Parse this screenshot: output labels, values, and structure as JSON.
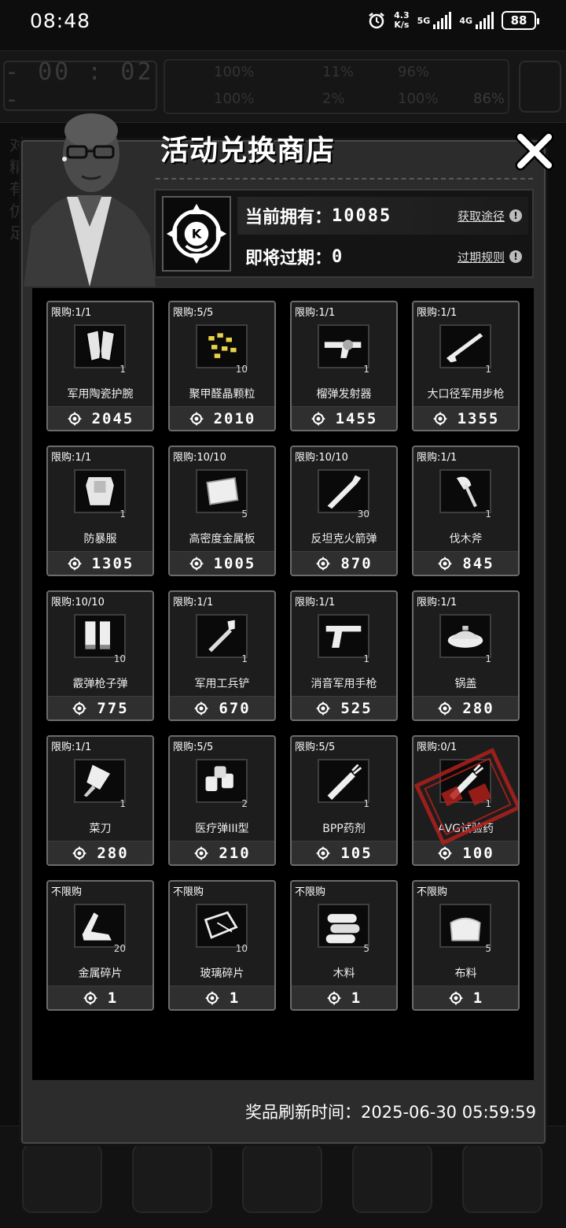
{
  "status_bar": {
    "time": "08:48",
    "speed_value": "4.3",
    "speed_unit": "K/s",
    "net1": "5G",
    "net2": "4G",
    "battery": "88",
    "alarm_icon": "alarm-icon"
  },
  "shop": {
    "title": "活动兑换商店",
    "currency": {
      "owned_label": "当前拥有：",
      "owned_value": "10085",
      "obtain_link": "获取途径",
      "expiring_label": "即将过期：",
      "expiring_value": "0",
      "expiry_rules_link": "过期规则"
    },
    "items": [
      {
        "limit": "限购:1/1",
        "name": "军用陶瓷护腕",
        "qty": "1",
        "price": "2045",
        "icon": "bracers-icon"
      },
      {
        "limit": "限购:5/5",
        "name": "聚甲醛晶颗粒",
        "qty": "10",
        "price": "2010",
        "icon": "pellets-icon"
      },
      {
        "limit": "限购:1/1",
        "name": "榴弹发射器",
        "qty": "1",
        "price": "1455",
        "icon": "grenade-launcher-icon"
      },
      {
        "limit": "限购:1/1",
        "name": "大口径军用步枪",
        "qty": "1",
        "price": "1355",
        "icon": "rifle-icon"
      },
      {
        "limit": "限购:1/1",
        "name": "防暴服",
        "qty": "1",
        "price": "1305",
        "icon": "riot-suit-icon"
      },
      {
        "limit": "限购:10/10",
        "name": "高密度金属板",
        "qty": "5",
        "price": "1005",
        "icon": "metal-plate-icon"
      },
      {
        "limit": "限购:10/10",
        "name": "反坦克火箭弹",
        "qty": "30",
        "price": "870",
        "icon": "rocket-icon"
      },
      {
        "limit": "限购:1/1",
        "name": "伐木斧",
        "qty": "1",
        "price": "845",
        "icon": "axe-icon"
      },
      {
        "limit": "限购:10/10",
        "name": "霰弹枪子弹",
        "qty": "10",
        "price": "775",
        "icon": "shotgun-shells-icon"
      },
      {
        "limit": "限购:1/1",
        "name": "军用工兵铲",
        "qty": "1",
        "price": "670",
        "icon": "shovel-icon"
      },
      {
        "limit": "限购:1/1",
        "name": "消音军用手枪",
        "qty": "1",
        "price": "525",
        "icon": "pistol-icon"
      },
      {
        "limit": "限购:1/1",
        "name": "锅盖",
        "qty": "1",
        "price": "280",
        "icon": "pot-lid-icon"
      },
      {
        "limit": "限购:1/1",
        "name": "菜刀",
        "qty": "1",
        "price": "280",
        "icon": "cleaver-icon"
      },
      {
        "limit": "限购:5/5",
        "name": "医疗弹III型",
        "qty": "2",
        "price": "210",
        "icon": "medical-ammo-icon"
      },
      {
        "limit": "限购:5/5",
        "name": "BPP药剂",
        "qty": "1",
        "price": "105",
        "icon": "syringe-icon"
      },
      {
        "limit": "限购:0/1",
        "name": "AVG试验药",
        "qty": "1",
        "price": "100",
        "icon": "syringe-icon",
        "sold_out": true,
        "stamp_color": "#b0201c"
      },
      {
        "limit": "不限购",
        "name": "金属碎片",
        "qty": "20",
        "price": "1",
        "icon": "metal-scraps-icon"
      },
      {
        "limit": "不限购",
        "name": "玻璃碎片",
        "qty": "10",
        "price": "1",
        "icon": "glass-shards-icon"
      },
      {
        "limit": "不限购",
        "name": "木料",
        "qty": "5",
        "price": "1",
        "icon": "logs-icon"
      },
      {
        "limit": "不限购",
        "name": "布料",
        "qty": "5",
        "price": "1",
        "icon": "cloth-icon"
      }
    ],
    "refresh_label": "奖品刷新时间：",
    "refresh_time": "2025-06-30 05:59:59"
  },
  "background_hud": {
    "timer": "- 00 : 02 -",
    "stats": [
      "100%",
      "11%",
      "96%",
      "100%",
      "2%",
      "100%",
      "86%"
    ],
    "side_text": [
      "对",
      "精",
      "有",
      "仿",
      "足"
    ]
  }
}
